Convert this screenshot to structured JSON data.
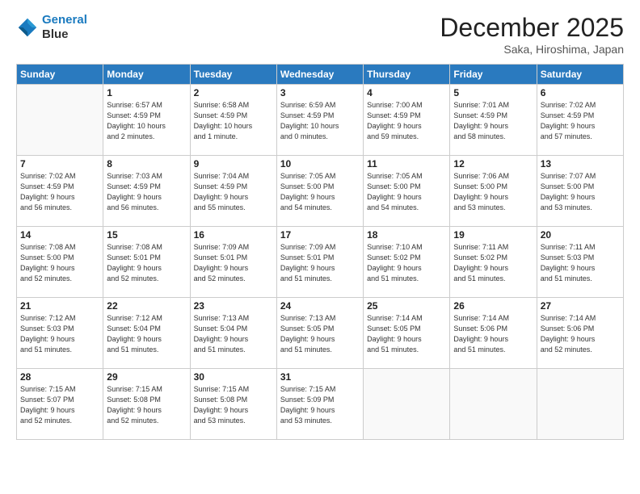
{
  "header": {
    "logo_line1": "General",
    "logo_line2": "Blue",
    "title": "December 2025",
    "location": "Saka, Hiroshima, Japan"
  },
  "weekdays": [
    "Sunday",
    "Monday",
    "Tuesday",
    "Wednesday",
    "Thursday",
    "Friday",
    "Saturday"
  ],
  "weeks": [
    [
      {
        "day": "",
        "info": ""
      },
      {
        "day": "1",
        "info": "Sunrise: 6:57 AM\nSunset: 4:59 PM\nDaylight: 10 hours\nand 2 minutes."
      },
      {
        "day": "2",
        "info": "Sunrise: 6:58 AM\nSunset: 4:59 PM\nDaylight: 10 hours\nand 1 minute."
      },
      {
        "day": "3",
        "info": "Sunrise: 6:59 AM\nSunset: 4:59 PM\nDaylight: 10 hours\nand 0 minutes."
      },
      {
        "day": "4",
        "info": "Sunrise: 7:00 AM\nSunset: 4:59 PM\nDaylight: 9 hours\nand 59 minutes."
      },
      {
        "day": "5",
        "info": "Sunrise: 7:01 AM\nSunset: 4:59 PM\nDaylight: 9 hours\nand 58 minutes."
      },
      {
        "day": "6",
        "info": "Sunrise: 7:02 AM\nSunset: 4:59 PM\nDaylight: 9 hours\nand 57 minutes."
      }
    ],
    [
      {
        "day": "7",
        "info": "Sunrise: 7:02 AM\nSunset: 4:59 PM\nDaylight: 9 hours\nand 56 minutes."
      },
      {
        "day": "8",
        "info": "Sunrise: 7:03 AM\nSunset: 4:59 PM\nDaylight: 9 hours\nand 56 minutes."
      },
      {
        "day": "9",
        "info": "Sunrise: 7:04 AM\nSunset: 4:59 PM\nDaylight: 9 hours\nand 55 minutes."
      },
      {
        "day": "10",
        "info": "Sunrise: 7:05 AM\nSunset: 5:00 PM\nDaylight: 9 hours\nand 54 minutes."
      },
      {
        "day": "11",
        "info": "Sunrise: 7:05 AM\nSunset: 5:00 PM\nDaylight: 9 hours\nand 54 minutes."
      },
      {
        "day": "12",
        "info": "Sunrise: 7:06 AM\nSunset: 5:00 PM\nDaylight: 9 hours\nand 53 minutes."
      },
      {
        "day": "13",
        "info": "Sunrise: 7:07 AM\nSunset: 5:00 PM\nDaylight: 9 hours\nand 53 minutes."
      }
    ],
    [
      {
        "day": "14",
        "info": "Sunrise: 7:08 AM\nSunset: 5:00 PM\nDaylight: 9 hours\nand 52 minutes."
      },
      {
        "day": "15",
        "info": "Sunrise: 7:08 AM\nSunset: 5:01 PM\nDaylight: 9 hours\nand 52 minutes."
      },
      {
        "day": "16",
        "info": "Sunrise: 7:09 AM\nSunset: 5:01 PM\nDaylight: 9 hours\nand 52 minutes."
      },
      {
        "day": "17",
        "info": "Sunrise: 7:09 AM\nSunset: 5:01 PM\nDaylight: 9 hours\nand 51 minutes."
      },
      {
        "day": "18",
        "info": "Sunrise: 7:10 AM\nSunset: 5:02 PM\nDaylight: 9 hours\nand 51 minutes."
      },
      {
        "day": "19",
        "info": "Sunrise: 7:11 AM\nSunset: 5:02 PM\nDaylight: 9 hours\nand 51 minutes."
      },
      {
        "day": "20",
        "info": "Sunrise: 7:11 AM\nSunset: 5:03 PM\nDaylight: 9 hours\nand 51 minutes."
      }
    ],
    [
      {
        "day": "21",
        "info": "Sunrise: 7:12 AM\nSunset: 5:03 PM\nDaylight: 9 hours\nand 51 minutes."
      },
      {
        "day": "22",
        "info": "Sunrise: 7:12 AM\nSunset: 5:04 PM\nDaylight: 9 hours\nand 51 minutes."
      },
      {
        "day": "23",
        "info": "Sunrise: 7:13 AM\nSunset: 5:04 PM\nDaylight: 9 hours\nand 51 minutes."
      },
      {
        "day": "24",
        "info": "Sunrise: 7:13 AM\nSunset: 5:05 PM\nDaylight: 9 hours\nand 51 minutes."
      },
      {
        "day": "25",
        "info": "Sunrise: 7:14 AM\nSunset: 5:05 PM\nDaylight: 9 hours\nand 51 minutes."
      },
      {
        "day": "26",
        "info": "Sunrise: 7:14 AM\nSunset: 5:06 PM\nDaylight: 9 hours\nand 51 minutes."
      },
      {
        "day": "27",
        "info": "Sunrise: 7:14 AM\nSunset: 5:06 PM\nDaylight: 9 hours\nand 52 minutes."
      }
    ],
    [
      {
        "day": "28",
        "info": "Sunrise: 7:15 AM\nSunset: 5:07 PM\nDaylight: 9 hours\nand 52 minutes."
      },
      {
        "day": "29",
        "info": "Sunrise: 7:15 AM\nSunset: 5:08 PM\nDaylight: 9 hours\nand 52 minutes."
      },
      {
        "day": "30",
        "info": "Sunrise: 7:15 AM\nSunset: 5:08 PM\nDaylight: 9 hours\nand 53 minutes."
      },
      {
        "day": "31",
        "info": "Sunrise: 7:15 AM\nSunset: 5:09 PM\nDaylight: 9 hours\nand 53 minutes."
      },
      {
        "day": "",
        "info": ""
      },
      {
        "day": "",
        "info": ""
      },
      {
        "day": "",
        "info": ""
      }
    ]
  ]
}
